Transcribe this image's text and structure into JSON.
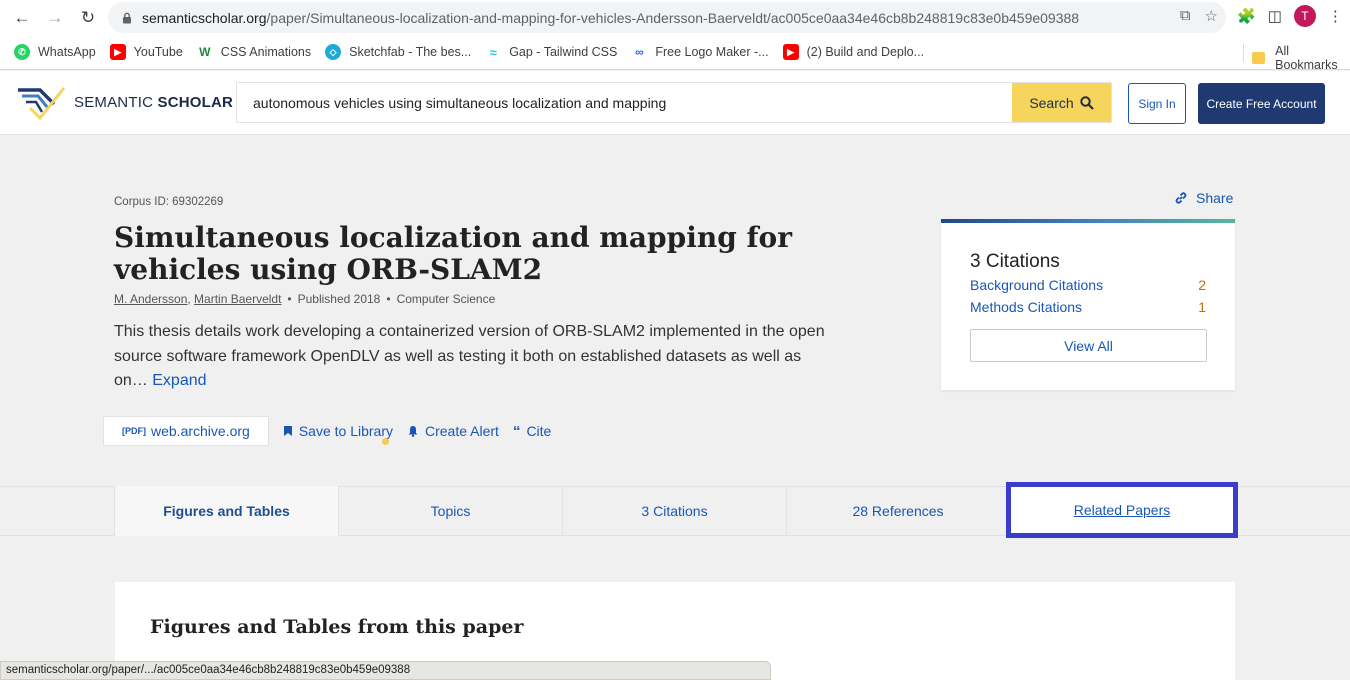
{
  "browser": {
    "url_domain": "semanticscholar.org",
    "url_path": "/paper/Simultaneous-localization-and-mapping-for-vehicles-Andersson-Baerveldt/ac005ce0aa34e46cb8b248819c83e0b459e09388",
    "avatar_initial": "T",
    "bookmarks": [
      {
        "label": "WhatsApp",
        "icon": "whatsapp-icon",
        "color": "#25d366"
      },
      {
        "label": "YouTube",
        "icon": "youtube-icon",
        "color": "#ff0000"
      },
      {
        "label": "CSS Animations",
        "icon": "w-icon",
        "color": "#1a8a3a"
      },
      {
        "label": "Sketchfab - The bes...",
        "icon": "sketchfab-icon",
        "color": "#1caad9"
      },
      {
        "label": "Gap - Tailwind CSS",
        "icon": "tailwind-icon",
        "color": "#38bdf8"
      },
      {
        "label": "Free Logo Maker -...",
        "icon": "logo-maker-icon",
        "color": "#2563eb"
      },
      {
        "label": "(2) Build and Deplo...",
        "icon": "youtube-icon",
        "color": "#ff0000"
      }
    ],
    "all_bookmarks": "All Bookmarks"
  },
  "header": {
    "logo_light": "SEMANTIC ",
    "logo_bold": "SCHOLAR",
    "search_value": "autonomous vehicles using simultaneous localization and mapping",
    "search_label": "Search",
    "signin_label": "Sign In",
    "create_label": "Create Free Account"
  },
  "paper": {
    "corpus_id": "Corpus ID: 69302269",
    "title": "Simultaneous localization and mapping for vehicles using ORB-SLAM2",
    "author1": "M. Andersson",
    "author2": "Martin Baerveldt",
    "published": "Published 2018",
    "field": "Computer Science",
    "abstract": "This thesis details work developing a containerized version of ORB-SLAM2 implemented in the open source software framework OpenDLV as well as testing it both on established datasets as well as on…",
    "expand": "Expand",
    "pdf_tag": "[PDF]",
    "pdf_source": "web.archive.org",
    "save_label": "Save to Library",
    "alert_label": "Create Alert",
    "cite_label": "Cite",
    "share_label": "Share"
  },
  "citations": {
    "title": "3 Citations",
    "background_label": "Background Citations",
    "background_count": "2",
    "methods_label": "Methods Citations",
    "methods_count": "1",
    "view_all": "View All"
  },
  "tabs": [
    {
      "label": "Figures and Tables"
    },
    {
      "label": "Topics"
    },
    {
      "label": "3 Citations"
    },
    {
      "label": "28 References"
    },
    {
      "label": "Related Papers"
    }
  ],
  "content": {
    "section_title": "Figures and Tables from this paper"
  },
  "status_bar": "semanticscholar.org/paper/.../ac005ce0aa34e46cb8b248819c83e0b459e09388",
  "colors": {
    "accent": "#1857b6",
    "search_button": "#f6d55c",
    "create_button": "#1e3a71",
    "highlight_border": "#3a3dcc",
    "citation_count": "#c26e10"
  }
}
